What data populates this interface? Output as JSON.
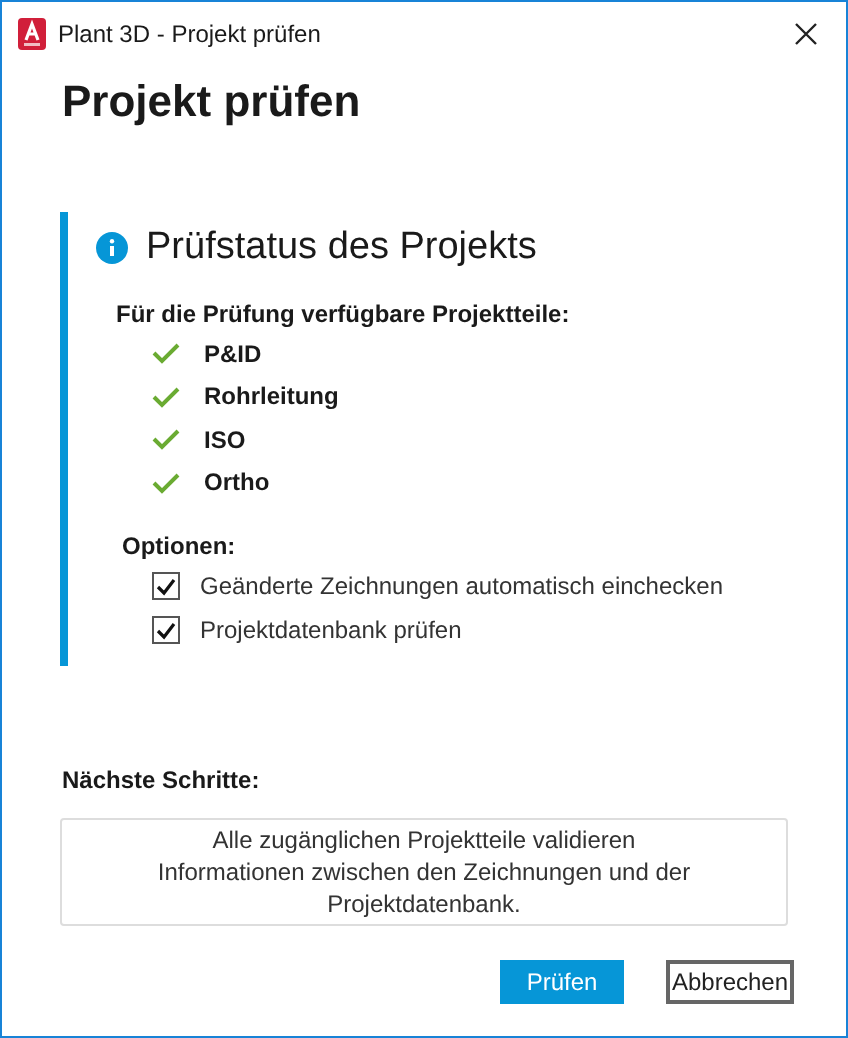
{
  "window": {
    "title": "Plant 3D - Projekt prüfen"
  },
  "heading": "Projekt prüfen",
  "status": {
    "title": "Prüfstatus des Projekts",
    "parts_label": "Für die Prüfung verfügbare Projektteile:",
    "parts": [
      {
        "label": "P&ID",
        "available": true
      },
      {
        "label": "Rohrleitung",
        "available": true
      },
      {
        "label": "ISO",
        "available": true
      },
      {
        "label": "Ortho",
        "available": true
      }
    ],
    "options_label": "Optionen:",
    "options": [
      {
        "label": "Geänderte Zeichnungen automatisch einchecken",
        "checked": true
      },
      {
        "label": "Projektdatenbank prüfen",
        "checked": true
      }
    ]
  },
  "next_steps": {
    "label": "Nächste Schritte:",
    "lines": [
      "Alle zugänglichen Projektteile validieren",
      "Informationen zwischen den Zeichnungen und der Projektdatenbank."
    ]
  },
  "buttons": [
    {
      "label": "Prüfen",
      "kind": "primary"
    },
    {
      "label": "Abbrechen",
      "kind": "secondary"
    }
  ]
}
